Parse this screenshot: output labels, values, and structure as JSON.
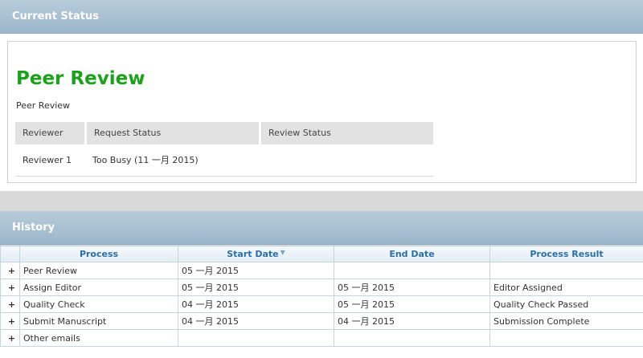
{
  "current_status": {
    "header": "Current Status",
    "title": "Peer Review",
    "subtitle": "Peer Review",
    "reviewer_table": {
      "columns": [
        "Reviewer",
        "Request Status",
        "Review Status"
      ],
      "rows": [
        {
          "reviewer": "Reviewer 1",
          "request_status": "Too Busy (11 一月 2015)",
          "review_status": ""
        }
      ]
    }
  },
  "history": {
    "header": "History",
    "columns": {
      "process": "Process",
      "start_date": "Start Date",
      "end_date": "End Date",
      "result": "Process Result"
    },
    "sort_icon": "sort-arrow-icon",
    "expander_symbol": "+",
    "rows": [
      {
        "process": "Peer Review",
        "start": "05 一月 2015",
        "end": "",
        "result": ""
      },
      {
        "process": "Assign Editor",
        "start": "05 一月 2015",
        "end": "05 一月 2015",
        "result": "Editor Assigned"
      },
      {
        "process": "Quality Check",
        "start": "04 一月 2015",
        "end": "05 一月 2015",
        "result": "Quality Check Passed"
      },
      {
        "process": "Submit Manuscript",
        "start": "04 一月 2015",
        "end": "04 一月 2015",
        "result": "Submission Complete"
      },
      {
        "process": "Other emails",
        "start": "",
        "end": "",
        "result": ""
      }
    ]
  },
  "colors": {
    "title_green": "#1aa31a",
    "header_blue": "#9bb6ca",
    "link_blue": "#2b6fa6"
  }
}
